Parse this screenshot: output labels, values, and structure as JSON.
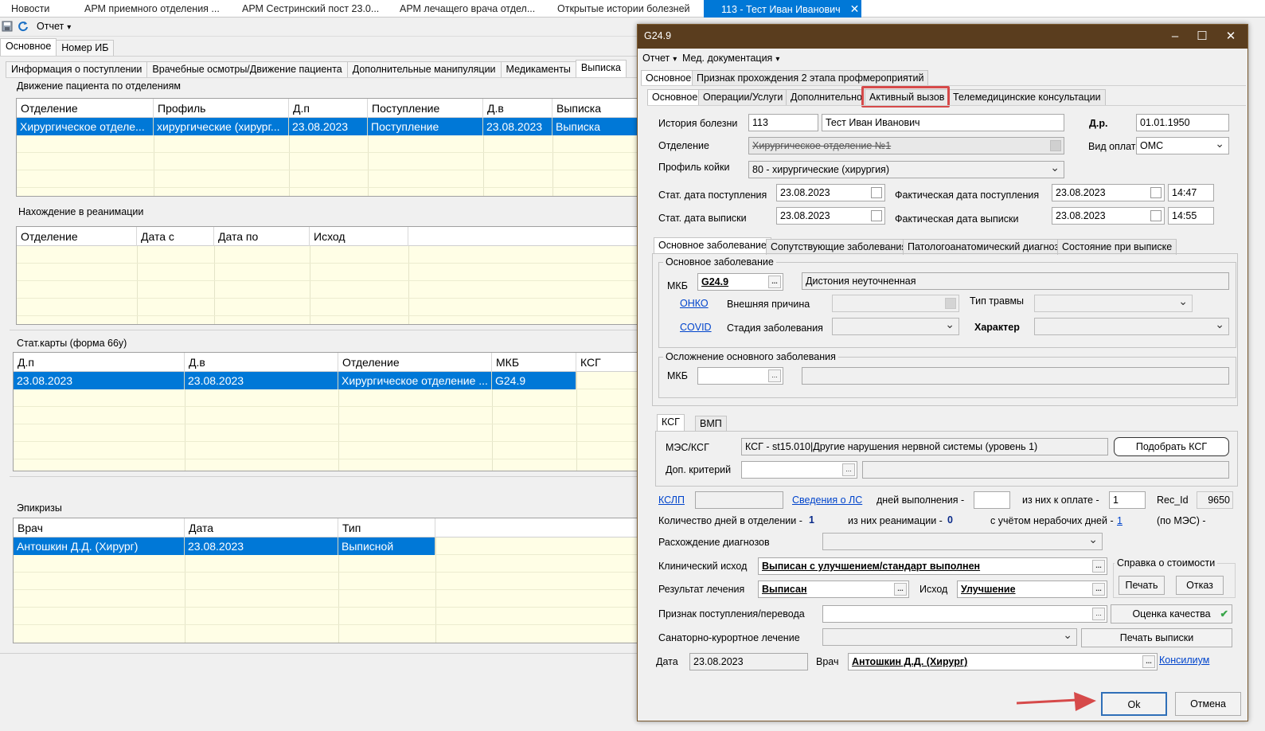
{
  "top_tabs": [
    {
      "label": "Новости"
    },
    {
      "label": "АРМ приемного отделения ..."
    },
    {
      "label": "АРМ Сестринский пост 23.0..."
    },
    {
      "label": "АРМ лечащего врача отдел..."
    },
    {
      "label": "Открытые истории болезней"
    },
    {
      "label": "113 - Тест Иван Иванович"
    }
  ],
  "toolbar": {
    "report_menu": "Отчет"
  },
  "left": {
    "outer_tabs": [
      "Основное",
      "Номер ИБ"
    ],
    "inner_tabs": [
      "Информация о поступлении",
      "Врачебные осмотры/Движение пациента",
      "Дополнительные манипуляции",
      "Медикаменты",
      "Выписка"
    ],
    "movement": {
      "title": "Движение пациента по отделениям",
      "columns": [
        "Отделение",
        "Профиль",
        "Д.п",
        "Поступление",
        "Д.в",
        "Выписка"
      ],
      "rows": [
        [
          "Хирургическое отделе...",
          "хирургические (хирург...",
          "23.08.2023",
          "Поступление",
          "23.08.2023",
          "Выписка"
        ]
      ]
    },
    "reanimation": {
      "title": "Нахождение в реанимации",
      "columns": [
        "Отделение",
        "Дата с",
        "Дата по",
        "Исход"
      ]
    },
    "statcards": {
      "title": "Стат.карты (форма 66у)",
      "columns": [
        "Д.п",
        "Д.в",
        "Отделение",
        "МКБ",
        "КСГ"
      ],
      "rows": [
        [
          "23.08.2023",
          "23.08.2023",
          "Хирургическое отделение ...",
          "G24.9"
        ]
      ]
    },
    "epicrises": {
      "title": "Эпикризы",
      "columns": [
        "Врач",
        "Дата",
        "Тип"
      ],
      "rows": [
        [
          "Антошкин Д.Д. (Хирург)",
          "23.08.2023",
          "Выписной"
        ]
      ]
    }
  },
  "dialog": {
    "title": "G24.9",
    "menu": [
      "Отчет",
      "Мед. документация"
    ],
    "outer_tabs": [
      "Основное",
      "Признак прохождения 2 этапа профмероприятий"
    ],
    "inner_tabs": [
      "Основное",
      "Операции/Услуги",
      "Дополнительно",
      "Активный вызов",
      "Телемедицинские консультации"
    ],
    "history_label": "История болезни",
    "history_no": "113",
    "patient_name": "Тест Иван Иванович",
    "dob_label": "Д.р.",
    "dob": "01.01.1950",
    "department_label": "Отделение",
    "department": "Хирургическое отделение №1",
    "payment_label": "Вид оплаты",
    "payment": "ОМС",
    "bed_profile_label": "Профиль койки",
    "bed_profile": "80 - хирургические (хирургия)",
    "stat_admit_label": "Стат. дата поступления",
    "stat_admit": "23.08.2023",
    "fact_admit_label": "Фактическая дата поступления",
    "fact_admit": "23.08.2023",
    "fact_admit_time": "14:47",
    "stat_discharge_label": "Стат. дата выписки",
    "stat_discharge": "23.08.2023",
    "fact_discharge_label": "Фактическая дата выписки",
    "fact_discharge": "23.08.2023",
    "fact_discharge_time": "14:55",
    "diag_tabs": [
      "Основное заболевание",
      "Сопутствующие заболевания",
      "Патологоанатомический диагноз",
      "Состояние при выписке"
    ],
    "main_disease_group": "Основное заболевание",
    "mkb_label": "МКБ",
    "mkb_code": "G24.9",
    "mkb_name": "Дистония неуточненная",
    "onko_link": "ОНКО",
    "external_cause_label": "Внешняя причина",
    "trauma_type_label": "Тип травмы",
    "covid_link": "COVID",
    "stage_label": "Стадия заболевания",
    "character_label": "Характер",
    "complication_group": "Осложнение основного заболевания",
    "ksg_tabs": [
      "КСГ",
      "ВМП"
    ],
    "mes_label": "МЭС/КСГ",
    "mes_value": "КСГ - st15.010|Другие нарушения нервной системы (уровень 1)",
    "pick_ksg_button": "Подобрать КСГ",
    "extra_criteria_label": "Доп. критерий",
    "kslp_link": "КСЛП",
    "ls_link": "Сведения о ЛС",
    "days_exec_label": "дней выполнения -",
    "paid_label": "из них к оплате -",
    "paid_value": "1",
    "rec_id_label": "Rec_Id",
    "rec_id": "9650",
    "days_in_dept_label": "Количество дней в отделении -",
    "days_in_dept": "1",
    "reanim_label": "из них реанимации -",
    "reanim_days": "0",
    "workdays_label": "с учётом нерабочих дней -",
    "workdays": "1",
    "by_mes_label": "(по МЭС) -",
    "diag_mismatch_label": "Расхождение диагнозов",
    "clinical_outcome_label": "Клинический исход",
    "clinical_outcome": "Выписан с улучшением/стандарт выполнен",
    "cost_group": "Справка о стоимости",
    "print_button": "Печать",
    "refuse_button": "Отказ",
    "treatment_result_label": "Результат лечения",
    "treatment_result": "Выписан",
    "outcome_label": "Исход",
    "outcome": "Улучшение",
    "admission_sign_label": "Признак поступления/перевода",
    "quality_button": "Оценка качества",
    "sanatorium_label": "Санаторно-курортное лечение",
    "print_discharge_button": "Печать выписки",
    "date_label": "Дата",
    "date_value": "23.08.2023",
    "doctor_label": "Врач",
    "doctor": "Антошкин Д.Д. (Хирург)",
    "consilium_link": "Консилиум",
    "ok_button": "Ok",
    "cancel_button": "Отмена"
  },
  "colors": {
    "accent": "#0078d7",
    "title_bar": "#5a3d1e",
    "highlight": "#d64a4a",
    "grid_bg": "#fffee6",
    "link": "#0044cc"
  },
  "icons": [
    "save-icon",
    "refresh-icon",
    "close-icon",
    "minimize-icon",
    "maximize-icon",
    "checkmark-icon",
    "arrow-icon"
  ]
}
